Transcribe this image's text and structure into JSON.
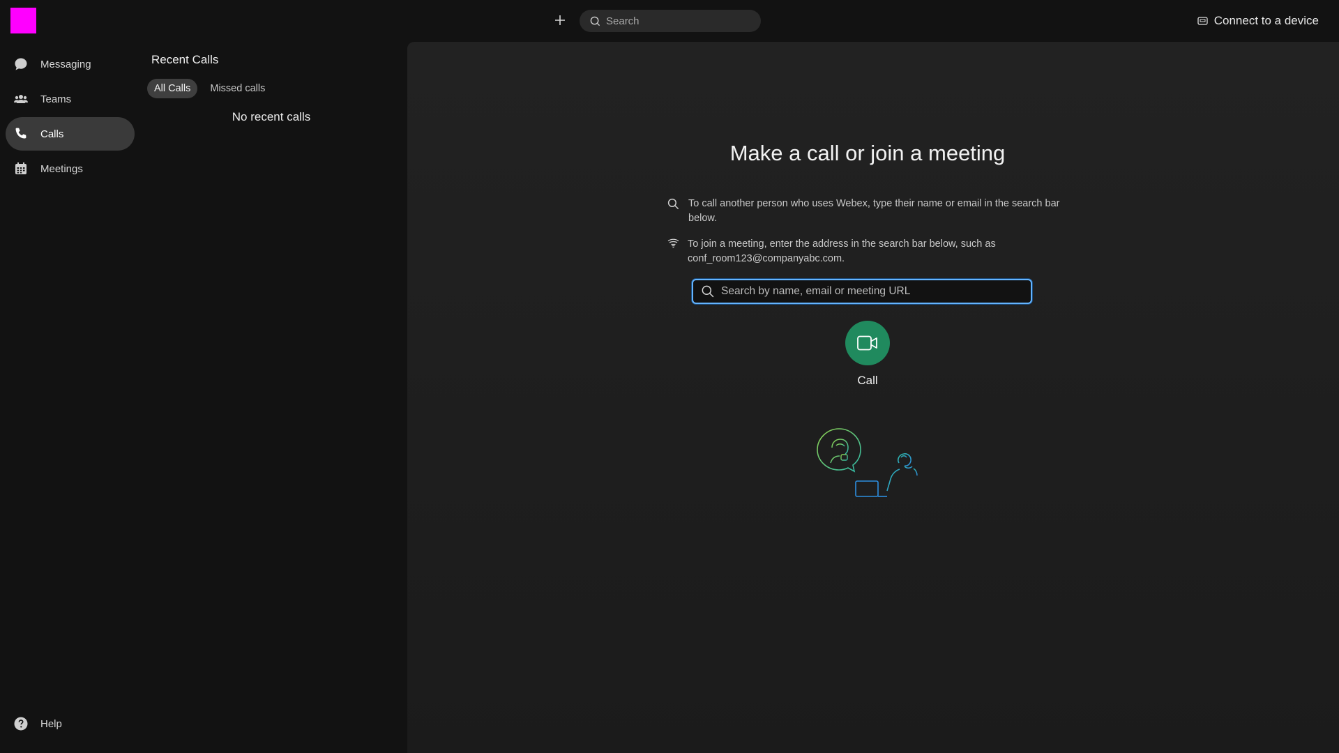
{
  "topbar": {
    "search_placeholder": "Search",
    "connect_label": "Connect to a device",
    "avatar_color": "#ff00ff"
  },
  "nav": {
    "items": [
      {
        "label": "Messaging",
        "icon": "chat-bubble-icon"
      },
      {
        "label": "Teams",
        "icon": "people-icon"
      },
      {
        "label": "Calls",
        "icon": "phone-icon",
        "active": true
      },
      {
        "label": "Meetings",
        "icon": "calendar-icon"
      }
    ],
    "help_label": "Help"
  },
  "recent": {
    "title": "Recent Calls",
    "filters": [
      {
        "label": "All Calls",
        "active": true
      },
      {
        "label": "Missed calls"
      }
    ],
    "empty_text": "No recent calls"
  },
  "main": {
    "title": "Make a call or join a meeting",
    "info_call": "To call another person who uses Webex, type their name or email in the search bar below.",
    "info_meeting": "To join a meeting, enter the address in the search bar below, such as conf_room123@companyabc.com.",
    "search_placeholder": "Search by name, email or meeting URL",
    "call_label": "Call",
    "call_button_color": "#208a5e",
    "search_focus_color": "#64b4ff"
  }
}
